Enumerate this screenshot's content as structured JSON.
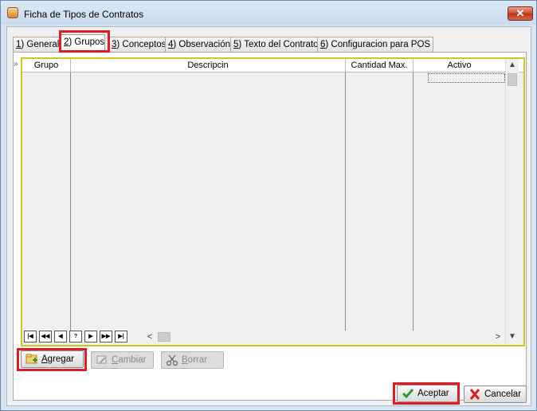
{
  "window": {
    "title": "Ficha de Tipos de Contratos",
    "close_label": "✕"
  },
  "tabs": [
    {
      "key": "1",
      "rest": ") General"
    },
    {
      "key": "2",
      "rest": ") Grupos"
    },
    {
      "key": "3",
      "rest": ") Conceptos"
    },
    {
      "key": "4",
      "rest": ") Observación"
    },
    {
      "key": "5",
      "rest": ") Texto del Contrato"
    },
    {
      "key": "6",
      "rest": ") Configuracion para POS"
    }
  ],
  "grid": {
    "row_indicator": "»",
    "columns": [
      "Grupo",
      "Descripcin",
      "Cantidad Max.",
      "Activo"
    ],
    "nav_buttons": [
      "|◀",
      "◀◀",
      "◀",
      "?",
      "▶",
      "▶▶",
      "▶|"
    ],
    "vscroll_up": "▲",
    "vscroll_down": "▼",
    "hscroll_left": "<",
    "hscroll_right": ">"
  },
  "buttons": {
    "agregar": {
      "key": "A",
      "rest": "gregar"
    },
    "cambiar": {
      "key": "C",
      "rest": "ambiar"
    },
    "borrar": {
      "key": "B",
      "rest": "orrar"
    },
    "aceptar": "Aceptar",
    "cancelar": "Cancelar"
  },
  "colors": {
    "highlight": "#e01b24",
    "grid_border": "#cfc71a",
    "accept_green": "#2e9a2e",
    "cancel_red": "#d42020"
  }
}
